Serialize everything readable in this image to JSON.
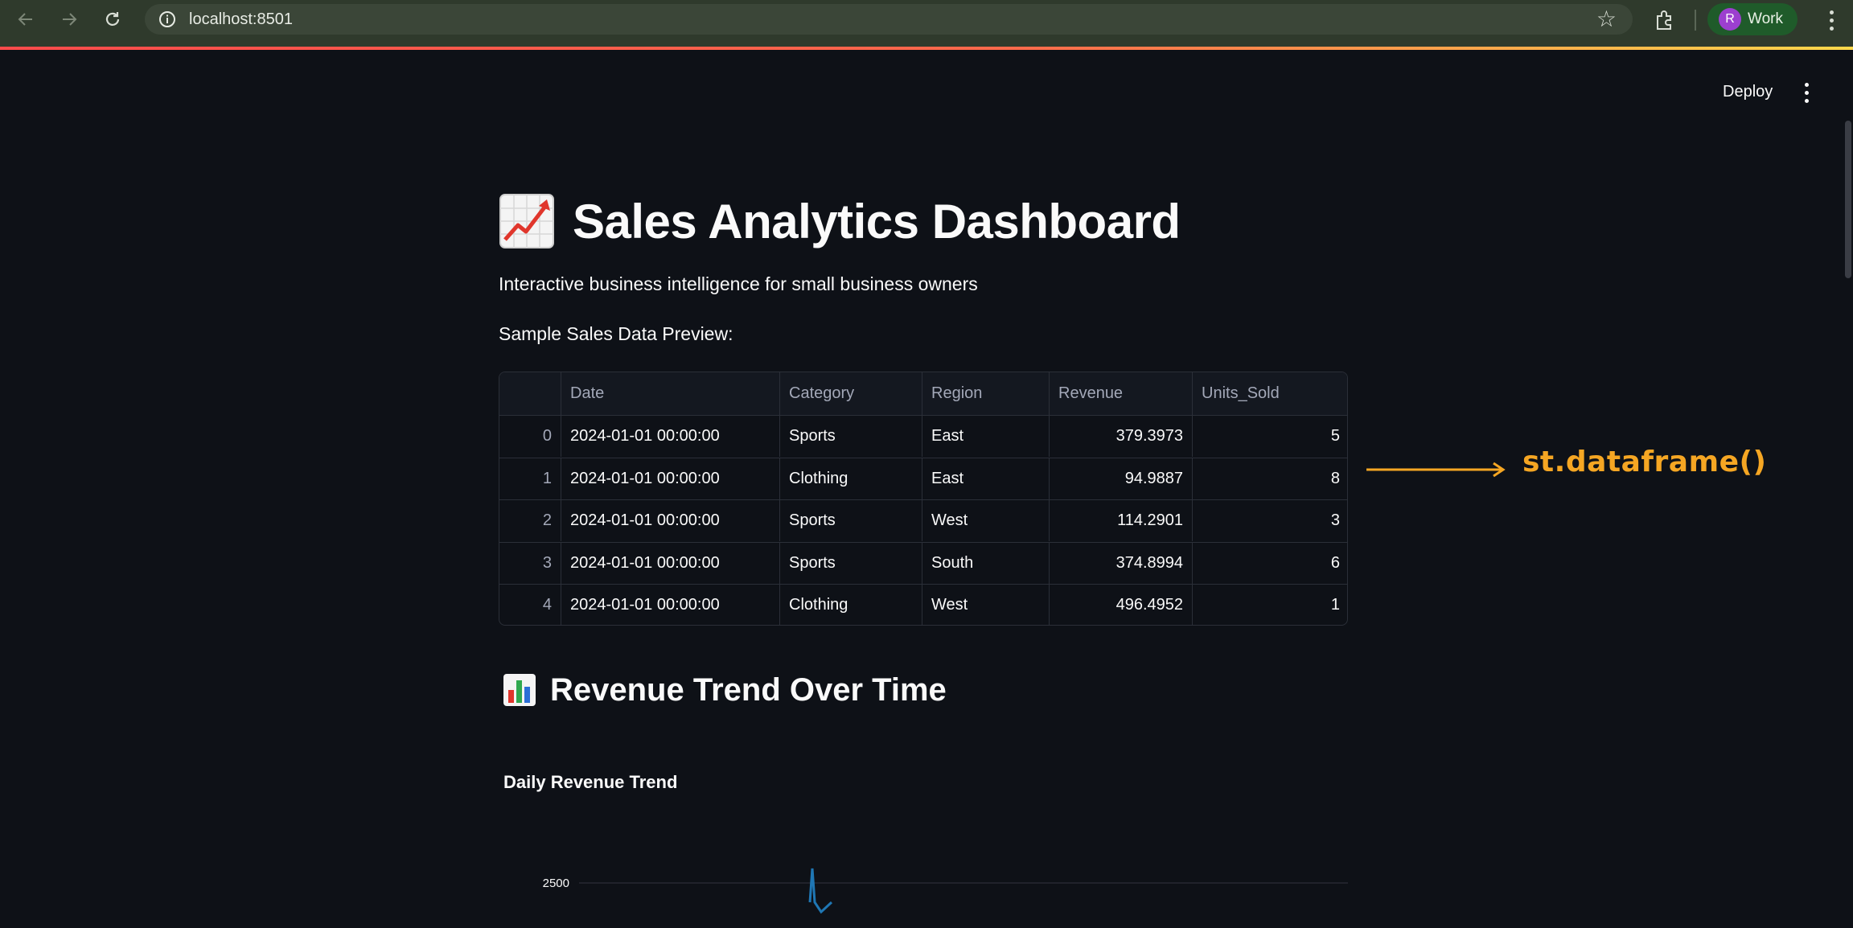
{
  "browser": {
    "url": "localhost:8501",
    "profile_initial": "R",
    "profile_name": "Work"
  },
  "app": {
    "deploy_label": "Deploy",
    "title": "Sales Analytics Dashboard",
    "title_icon": "chart-increasing-icon",
    "subtitle": "Interactive business intelligence for small business owners",
    "preview_label": "Sample Sales Data Preview:"
  },
  "table": {
    "columns": [
      "",
      "Date",
      "Category",
      "Region",
      "Revenue",
      "Units_Sold"
    ],
    "rows": [
      {
        "index": "0",
        "date": "2024-01-01 00:00:00",
        "category": "Sports",
        "region": "East",
        "revenue": "379.3973",
        "units": "5"
      },
      {
        "index": "1",
        "date": "2024-01-01 00:00:00",
        "category": "Clothing",
        "region": "East",
        "revenue": "94.9887",
        "units": "8"
      },
      {
        "index": "2",
        "date": "2024-01-01 00:00:00",
        "category": "Sports",
        "region": "West",
        "revenue": "114.2901",
        "units": "3"
      },
      {
        "index": "3",
        "date": "2024-01-01 00:00:00",
        "category": "Sports",
        "region": "South",
        "revenue": "374.8994",
        "units": "6"
      },
      {
        "index": "4",
        "date": "2024-01-01 00:00:00",
        "category": "Clothing",
        "region": "West",
        "revenue": "496.4952",
        "units": "1"
      }
    ]
  },
  "annotation": {
    "label": "st.dataframe()",
    "color": "#f5a623"
  },
  "section": {
    "heading": "Revenue Trend Over Time",
    "heading_icon": "bar-chart-icon",
    "chart_title": "Daily Revenue Trend"
  },
  "chart_data": {
    "type": "line",
    "title": "Daily Revenue Trend",
    "y_ticks": [
      2500
    ],
    "series": [
      {
        "color": "#1f77b4",
        "values": [
          2300,
          2650,
          2300,
          2200,
          2300
        ]
      }
    ]
  },
  "colors": {
    "background": "#0e1117",
    "accent": "#ff4b4b",
    "line": "#1f77b4"
  }
}
